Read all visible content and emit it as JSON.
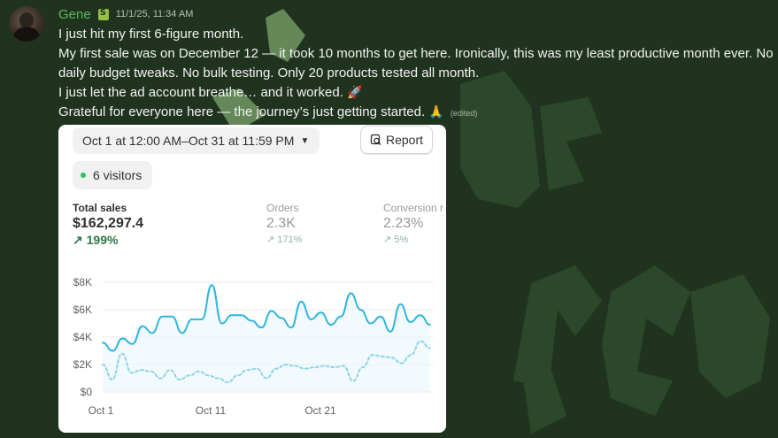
{
  "message": {
    "username": "Gene",
    "timestamp": "11/1/25, 11:34 AM",
    "lines": [
      "I just hit my first 6-figure month.",
      "My first sale was on December 12 — it took 10 months to get here. Ironically, this was my least productive month ever. No",
      "daily budget tweaks. No bulk testing. Only 20 products tested all month.",
      "I just let the ad account breathe… and it worked.",
      "Grateful for everyone here — the journey’s just getting started."
    ],
    "rocket_emoji": "🚀",
    "pray_emoji": "🙏",
    "edited_label": "(edited)",
    "role_icon": "shopify-bag-icon"
  },
  "analytics": {
    "date_range": "Oct 1 at 12:00 AM–Oct 31 at 11:59 PM",
    "report_label": "Report",
    "visitors_label": "6 visitors",
    "metrics": [
      {
        "label": "Total sales",
        "value": "$162,297.4",
        "change": "199%"
      },
      {
        "label": "Orders",
        "value": "2.3K",
        "change": "171%"
      },
      {
        "label": "Conversion r",
        "value": "2.23%",
        "change": "5%"
      }
    ]
  },
  "chart_data": {
    "type": "line",
    "y_tick_labels": [
      "$8K",
      "$6K",
      "$4K",
      "$2K",
      "$0"
    ],
    "x_tick_labels": [
      "Oct 1",
      "Oct 11",
      "Oct 21"
    ],
    "ylim": [
      0,
      8000
    ],
    "grid": true,
    "series": [
      {
        "style": "solid",
        "color": "#2fb5dc",
        "values": [
          3600,
          3000,
          3900,
          3500,
          4800,
          4300,
          5500,
          5500,
          4300,
          5300,
          5300,
          7800,
          5000,
          5600,
          5600,
          5200,
          4700,
          5900,
          5400,
          4700,
          6600,
          5300,
          5800,
          4900,
          5500,
          7200,
          6000,
          5000,
          5500,
          4400,
          6400,
          5100,
          5600,
          4900
        ]
      },
      {
        "style": "dashed",
        "color": "#8dd4ea",
        "values": [
          2000,
          900,
          2800,
          1400,
          1600,
          1500,
          1000,
          1600,
          900,
          1200,
          1500,
          1200,
          1000,
          700,
          1200,
          1600,
          1700,
          1000,
          1700,
          2000,
          1900,
          1700,
          1800,
          1900,
          1800,
          1900,
          800,
          1800,
          2700,
          2600,
          2500,
          2100,
          2700,
          3700,
          3200
        ]
      }
    ]
  }
}
